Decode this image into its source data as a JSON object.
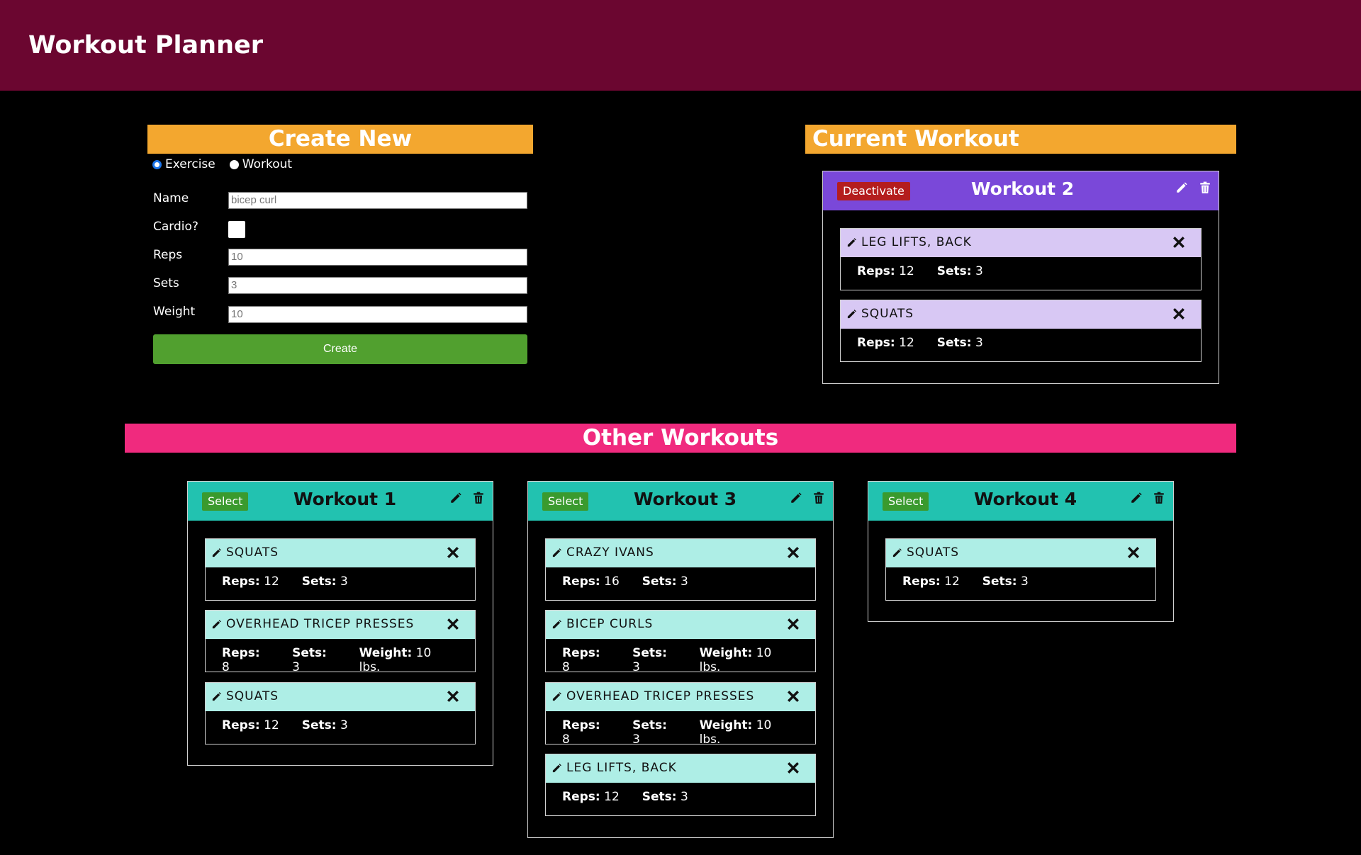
{
  "app": {
    "title": "Workout Planner"
  },
  "create": {
    "header": "Create New",
    "type_options": [
      "Exercise",
      "Workout"
    ],
    "selected_type": "Exercise",
    "name_label": "Name",
    "name_placeholder": "bicep curl",
    "cardio_label": "Cardio?",
    "reps_label": "Reps",
    "reps_placeholder": "10",
    "sets_label": "Sets",
    "sets_placeholder": "3",
    "weight_label": "Weight",
    "weight_placeholder": "10",
    "button_label": "Create"
  },
  "current": {
    "header": "Current Workout",
    "workout": {
      "title": "Workout 2",
      "action_label": "Deactivate",
      "exercises": [
        {
          "name": "LEG LIFTS, BACK",
          "reps": "12",
          "sets": "3"
        },
        {
          "name": "SQUATS",
          "reps": "12",
          "sets": "3"
        }
      ]
    }
  },
  "other": {
    "header": "Other Workouts",
    "workouts": [
      {
        "title": "Workout 1",
        "action_label": "Select",
        "exercises": [
          {
            "name": "SQUATS",
            "reps": "12",
            "sets": "3"
          },
          {
            "name": "OVERHEAD TRICEP PRESSES",
            "reps": "8",
            "sets": "3",
            "weight": "10 lbs."
          },
          {
            "name": "SQUATS",
            "reps": "12",
            "sets": "3"
          }
        ]
      },
      {
        "title": "Workout 3",
        "action_label": "Select",
        "exercises": [
          {
            "name": "CRAZY IVANS",
            "reps": "16",
            "sets": "3"
          },
          {
            "name": "BICEP CURLS",
            "reps": "8",
            "sets": "3",
            "weight": "10 lbs."
          },
          {
            "name": "OVERHEAD TRICEP PRESSES",
            "reps": "8",
            "sets": "3",
            "weight": "10 lbs."
          },
          {
            "name": "LEG LIFTS, BACK",
            "reps": "12",
            "sets": "3"
          }
        ]
      },
      {
        "title": "Workout 4",
        "action_label": "Select",
        "exercises": [
          {
            "name": "SQUATS",
            "reps": "12",
            "sets": "3"
          }
        ]
      }
    ]
  },
  "labels": {
    "reps": "Reps:",
    "sets": "Sets:",
    "weight": "Weight:"
  },
  "colors": {
    "topbar": "#6b0630",
    "section_orange": "#f3a72f",
    "section_pink": "#f02a7e",
    "current_card": "#7a48d9",
    "other_card": "#22c2b0",
    "deactivate": "#b41d1d",
    "select": "#3a9a2e",
    "create_button": "#51a02f"
  }
}
